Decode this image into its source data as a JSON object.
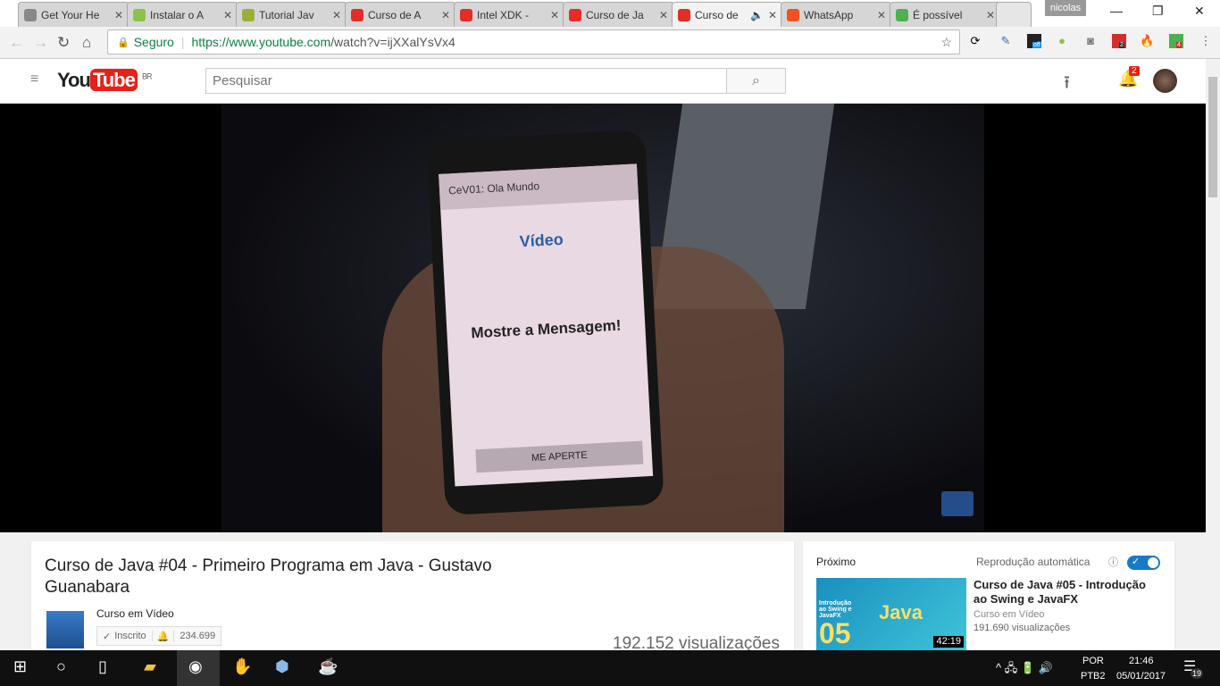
{
  "browser": {
    "tabs": [
      {
        "label": "Get Your He",
        "icon": "page-icon",
        "color": "#888"
      },
      {
        "label": "Instalar o A",
        "icon": "android-icon",
        "color": "#8bc34a"
      },
      {
        "label": "Tutorial Jav",
        "icon": "m-icon",
        "color": "#9aae3a"
      },
      {
        "label": "Curso de A",
        "icon": "youtube-icon",
        "color": "#e52d27"
      },
      {
        "label": "Intel XDK -",
        "icon": "youtube-icon",
        "color": "#e52d27"
      },
      {
        "label": "Curso de Ja",
        "icon": "youtube-icon",
        "color": "#e52d27"
      },
      {
        "label": "Curso de",
        "icon": "youtube-icon",
        "color": "#e52d27"
      },
      {
        "label": "WhatsApp",
        "icon": "whatsapp-icon",
        "color": "#f4511e"
      },
      {
        "label": "É possível",
        "icon": "stackoverflow-icon",
        "color": "#4caf50"
      }
    ],
    "user": "nicolas",
    "secure_label": "Seguro",
    "url_host": "https://www.youtube.com",
    "url_path": "/watch?v=ijXXalYsVx4",
    "ext_badges": [
      "off",
      "2",
      "4"
    ]
  },
  "youtube": {
    "logo_you": "You",
    "logo_tube": "Tube",
    "region": "BR",
    "search_placeholder": "Pesquisar",
    "notif_count": "2"
  },
  "video_frame": {
    "app_title": "CeV01: Ola Mundo",
    "message": "Mostre a Mensagem!",
    "button": "ME APERTE",
    "logo": "Vídeo"
  },
  "info": {
    "title": "Curso de Java #04 - Primeiro Programa em Java - Gustavo Guanabara",
    "channel": "Curso em Vídeo",
    "subscribed": "Inscrito",
    "subscribers": "234.699",
    "views": "192.152 visualizações"
  },
  "next": {
    "heading": "Próximo",
    "autoplay": "Reprodução automática",
    "autoplay_on": true,
    "title": "Curso de Java #05 - Introdução ao Swing e JavaFX",
    "channel": "Curso em Vídeo",
    "views": "191.690 visualizações",
    "thumb_text": "Introdução ao Swing e JavaFX",
    "thumb_big": "Java",
    "thumb_num": "05",
    "duration": "42:19"
  },
  "taskbar": {
    "lang": "POR",
    "layout": "PTB2",
    "time": "21:46",
    "date": "05/01/2017",
    "notifications": "19"
  }
}
